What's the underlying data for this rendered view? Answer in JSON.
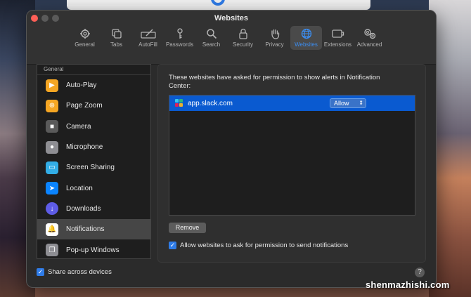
{
  "window": {
    "title": "Websites"
  },
  "toolbar": [
    {
      "label": "General",
      "icon": "gear-icon"
    },
    {
      "label": "Tabs",
      "icon": "tabs-icon"
    },
    {
      "label": "AutoFill",
      "icon": "pencil-icon"
    },
    {
      "label": "Passwords",
      "icon": "key-icon"
    },
    {
      "label": "Search",
      "icon": "search-icon"
    },
    {
      "label": "Security",
      "icon": "lock-icon"
    },
    {
      "label": "Privacy",
      "icon": "hand-icon"
    },
    {
      "label": "Websites",
      "icon": "globe-icon",
      "active": true
    },
    {
      "label": "Extensions",
      "icon": "puzzle-icon"
    },
    {
      "label": "Advanced",
      "icon": "gears-icon"
    }
  ],
  "sidebar": {
    "header": "General",
    "items": [
      {
        "label": "Auto-Play",
        "icon": "play-icon",
        "color": "#f5a623"
      },
      {
        "label": "Page Zoom",
        "icon": "zoom-icon",
        "color": "#f5a623"
      },
      {
        "label": "Camera",
        "icon": "camera-icon",
        "color": "#5a5a5a"
      },
      {
        "label": "Microphone",
        "icon": "microphone-icon",
        "color": "#8e8e93"
      },
      {
        "label": "Screen Sharing",
        "icon": "screen-icon",
        "color": "#32ade6"
      },
      {
        "label": "Location",
        "icon": "location-icon",
        "color": "#0a84ff"
      },
      {
        "label": "Downloads",
        "icon": "download-icon",
        "color": "#5e5ce6"
      },
      {
        "label": "Notifications",
        "icon": "bell-icon",
        "color": "#ff3b30",
        "selected": true
      },
      {
        "label": "Pop-up Windows",
        "icon": "popup-icon",
        "color": "#8e8e93"
      }
    ]
  },
  "content": {
    "description": "These websites have asked for permission to show alerts in Notification Center:",
    "sites": [
      {
        "name": "app.slack.com",
        "setting": "Allow"
      }
    ],
    "remove_label": "Remove",
    "allow_ask_label": "Allow websites to ask for permission to send notifications",
    "allow_ask_checked": true
  },
  "footer": {
    "share_label": "Share across devices",
    "share_checked": true,
    "help": "?"
  },
  "watermark": "shenmazhishi.com"
}
